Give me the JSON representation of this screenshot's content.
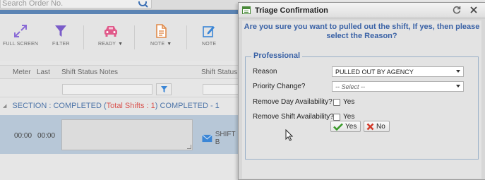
{
  "app": {
    "search": {
      "placeholder": "Search Order No."
    },
    "toolbar": [
      {
        "label": "FULL SCREEN",
        "icon": "expand-arrows-icon",
        "caret": false
      },
      {
        "label": "FILTER",
        "icon": "funnel-icon",
        "caret": false
      },
      {
        "label": "READY",
        "icon": "car-icon",
        "caret": true
      },
      {
        "label": "NOTE",
        "icon": "document-icon",
        "caret": true
      },
      {
        "label": "NOTE",
        "icon": "edit-icon",
        "caret": false
      }
    ],
    "grid": {
      "columns": [
        "Meter",
        "Last",
        "Shift Status Notes",
        "Shift Status"
      ],
      "section": {
        "prefix": "SECTION : COMPLETED (",
        "total_shifts": "Total Shifts : 1",
        "suffix": ") COMPLETED - 1"
      },
      "row": {
        "meter": "00:00",
        "last": "00:00",
        "notes": "",
        "status": "SHIFT B"
      }
    }
  },
  "dialog": {
    "title": "Triage Confirmation",
    "question": "Are you sure you want to pulled out the shift, If yes, then please select the Reason?",
    "section_legend": "Professional",
    "fields": {
      "reason_label": "Reason",
      "reason_value": "PULLED OUT BY AGENCY",
      "priority_label": "Priority Change?",
      "priority_value": "-- Select --",
      "remove_day_label": "Remove Day Availability?",
      "remove_day_check_label": "Yes",
      "remove_day_checked": false,
      "remove_shift_label": "Remove Shift Availability?",
      "remove_shift_check_label": "Yes",
      "remove_shift_checked": false
    },
    "buttons": {
      "yes": "Yes",
      "no": "No"
    }
  },
  "colors": {
    "accent_blue": "#3a62a6",
    "section_red": "#d9534f",
    "selected_row": "#b7c7d7",
    "toolbar_purple": "#7a5cc9",
    "toolbar_pink": "#e05a8a",
    "toolbar_orange": "#e08a4a",
    "toolbar_blue": "#3b86d6",
    "yes_check_green": "#3a9a2a",
    "no_x_red": "#d23a2a"
  }
}
